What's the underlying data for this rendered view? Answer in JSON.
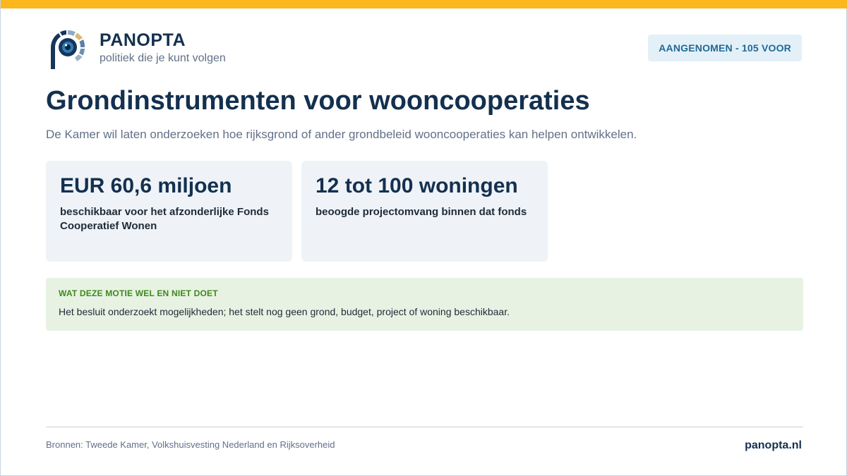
{
  "brand": {
    "name": "PANOPTA",
    "tagline": "politiek die je kunt volgen",
    "logo_icon": "panopta-eye-logo-icon"
  },
  "status": {
    "label": "AANGENOMEN - 105 VOOR"
  },
  "headline": {
    "title": "Grondinstrumenten voor wooncooperaties",
    "subtitle": "De Kamer wil laten onderzoeken hoe rijksgrond of ander grondbeleid wooncooperaties kan helpen ontwikkelen."
  },
  "stats": [
    {
      "value": "EUR 60,6 miljoen",
      "label": "beschikbaar voor het afzonderlijke Fonds Cooperatief Wonen"
    },
    {
      "value": "12 tot 100 woningen",
      "label": "beoogde projectomvang binnen dat fonds"
    }
  ],
  "note": {
    "heading": "WAT DEZE MOTIE WEL EN NIET DOET",
    "text": "Het besluit onderzoekt mogelijkheden; het stelt nog geen grond, budget, project of woning beschikbaar."
  },
  "footer": {
    "sources": "Bronnen: Tweede Kamer, Volkshuisvesting Nederland en Rijksoverheid",
    "site": "panopta.nl"
  },
  "colors": {
    "accent_bar": "#fbb71c",
    "navy": "#14304f",
    "badge_bg": "#e4f0f8",
    "card_bg": "#eff3f7",
    "note_bg": "#e8f2e3",
    "note_heading": "#3c8a1c"
  }
}
